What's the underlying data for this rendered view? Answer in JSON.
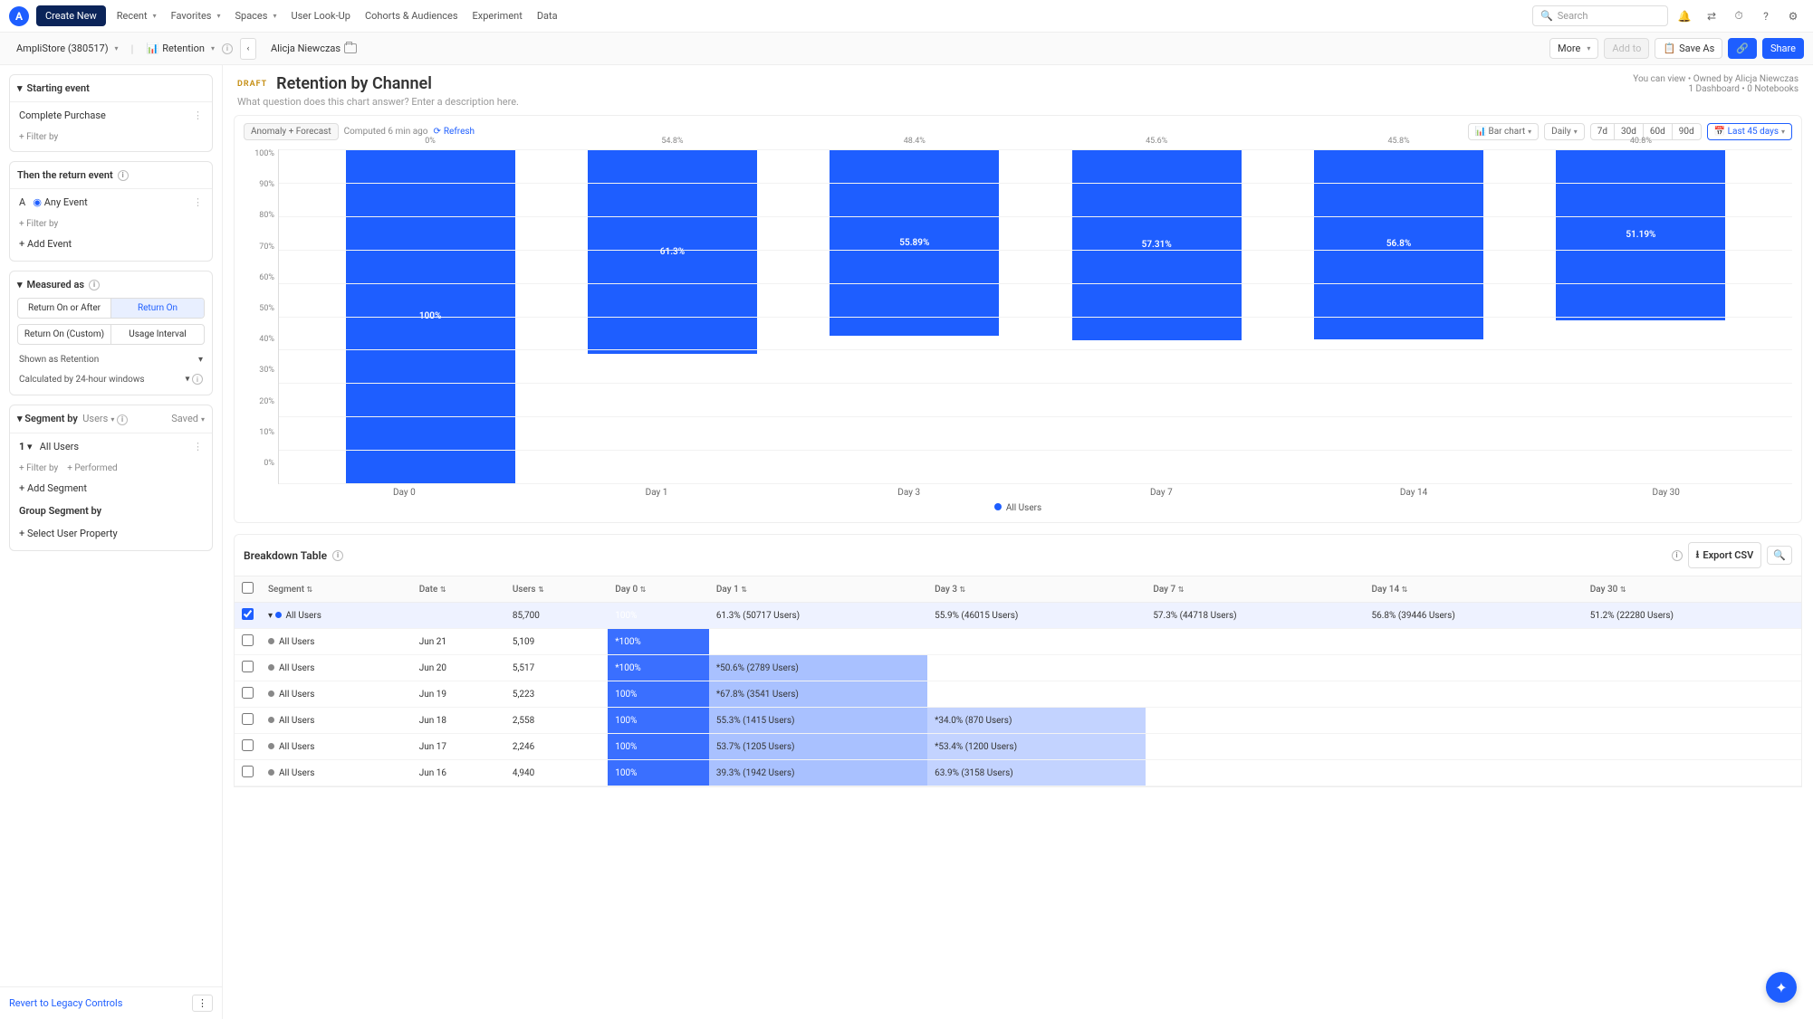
{
  "nav": {
    "create": "Create New",
    "items": [
      "Recent",
      "Favorites",
      "Spaces",
      "User Look-Up",
      "Cohorts & Audiences",
      "Experiment",
      "Data"
    ],
    "search_ph": "Search"
  },
  "subnav": {
    "project": "AmpliStore (380517)",
    "analysis": "Retention",
    "user": "Alicja Niewczas",
    "more": "More",
    "addto": "Add to",
    "saveas": "Save As",
    "share": "Share"
  },
  "title": {
    "badge": "DRAFT",
    "text": "Retention by Channel",
    "desc": "What question does this chart answer? Enter a description here.",
    "meta1": "You can view • Owned by Alicja Niewczas",
    "meta2": "1 Dashboard • 0 Notebooks"
  },
  "sidebar": {
    "starting_event": "Starting event",
    "complete_purchase": "Complete Purchase",
    "filter_by": "+ Filter by",
    "return_event": "Then the return event",
    "any_event": "Any Event",
    "add_event": "+ Add Event",
    "measured_as": "Measured as",
    "m_btns": [
      "Return On or After",
      "Return On",
      "Return On (Custom)",
      "Usage Interval"
    ],
    "shown_as": "Shown as Retention",
    "calc_by": "Calculated by 24-hour windows",
    "segment_by": "Segment by",
    "users": "Users",
    "saved": "Saved",
    "all_users": "All Users",
    "performed": "+ Performed",
    "add_segment": "+ Add Segment",
    "group_by": "Group Segment by",
    "select_prop": "+ Select User Property",
    "revert": "Revert to Legacy Controls"
  },
  "chart_toolbar": {
    "anomaly": "Anomaly + Forecast",
    "computed": "Computed 6 min ago",
    "refresh": "Refresh",
    "type": "Bar chart",
    "granularity": "Daily",
    "ranges": [
      "7d",
      "30d",
      "60d",
      "90d"
    ],
    "last": "Last 45 days"
  },
  "chart_data": {
    "type": "bar",
    "categories": [
      "Day 0",
      "Day 1",
      "Day 3",
      "Day 7",
      "Day 14",
      "Day 30"
    ],
    "values": [
      100,
      61.3,
      55.89,
      57.31,
      56.8,
      51.19
    ],
    "bar_labels": [
      "100%",
      "61.3%",
      "55.89%",
      "57.31%",
      "56.8%",
      "51.19%"
    ],
    "top_labels": [
      "0%",
      "54.8%",
      "48.4%",
      "45.6%",
      "45.8%",
      "40.8%"
    ],
    "yticks": [
      "100%",
      "90%",
      "80%",
      "70%",
      "60%",
      "50%",
      "40%",
      "30%",
      "20%",
      "10%",
      "0%"
    ],
    "ylim": [
      0,
      100
    ],
    "legend": "All Users"
  },
  "breakdown": {
    "title": "Breakdown Table",
    "export": "Export CSV",
    "cols": [
      "Segment",
      "Date",
      "Users",
      "Day 0",
      "Day 1",
      "Day 3",
      "Day 7",
      "Day 14",
      "Day 30"
    ],
    "rows": [
      {
        "seg": "All Users",
        "date": "",
        "users": "85,700",
        "d0": "100%",
        "d1": "61.3% (50717 Users)",
        "d3": "55.9% (46015 Users)",
        "d7": "57.3% (44718 Users)",
        "d14": "56.8% (39446 Users)",
        "d30": "51.2% (22280 Users)",
        "hdr": true
      },
      {
        "seg": "All Users",
        "date": "Jun 21",
        "users": "5,109",
        "d0": "*100%",
        "d1": "",
        "d3": "",
        "d7": "",
        "d14": "",
        "d30": ""
      },
      {
        "seg": "All Users",
        "date": "Jun 20",
        "users": "5,517",
        "d0": "*100%",
        "d1": "*50.6% (2789 Users)",
        "d3": "",
        "d7": "",
        "d14": "",
        "d30": ""
      },
      {
        "seg": "All Users",
        "date": "Jun 19",
        "users": "5,223",
        "d0": "100%",
        "d1": "*67.8% (3541 Users)",
        "d3": "",
        "d7": "",
        "d14": "",
        "d30": ""
      },
      {
        "seg": "All Users",
        "date": "Jun 18",
        "users": "2,558",
        "d0": "100%",
        "d1": "55.3% (1415 Users)",
        "d3": "*34.0% (870 Users)",
        "d7": "",
        "d14": "",
        "d30": ""
      },
      {
        "seg": "All Users",
        "date": "Jun 17",
        "users": "2,246",
        "d0": "100%",
        "d1": "53.7% (1205 Users)",
        "d3": "*53.4% (1200 Users)",
        "d7": "",
        "d14": "",
        "d30": ""
      },
      {
        "seg": "All Users",
        "date": "Jun 16",
        "users": "4,940",
        "d0": "100%",
        "d1": "39.3% (1942 Users)",
        "d3": "63.9% (3158 Users)",
        "d7": "",
        "d14": "",
        "d30": ""
      }
    ]
  }
}
